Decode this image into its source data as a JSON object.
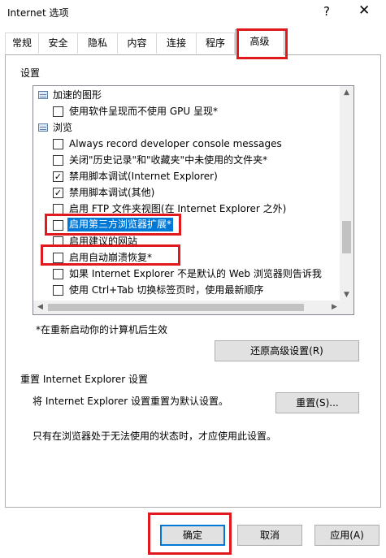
{
  "window": {
    "title": "Internet 选项",
    "help_glyph": "?",
    "close_glyph": "✕"
  },
  "tabs": [
    {
      "label": "常规"
    },
    {
      "label": "安全"
    },
    {
      "label": "隐私"
    },
    {
      "label": "内容"
    },
    {
      "label": "连接"
    },
    {
      "label": "程序"
    },
    {
      "label": "高级",
      "active": true
    }
  ],
  "settings": {
    "heading": "设置",
    "items": [
      {
        "type": "category",
        "label": "加速的图形"
      },
      {
        "type": "check",
        "checked": false,
        "label": "使用软件呈现而不使用 GPU 呈现*"
      },
      {
        "type": "category",
        "label": "浏览"
      },
      {
        "type": "check",
        "checked": false,
        "label": "Always record developer console messages"
      },
      {
        "type": "check",
        "checked": false,
        "label": "关闭\"历史记录\"和\"收藏夹\"中未使用的文件夹*"
      },
      {
        "type": "check",
        "checked": true,
        "label": "禁用脚本调试(Internet Explorer)"
      },
      {
        "type": "check",
        "checked": true,
        "label": "禁用脚本调试(其他)"
      },
      {
        "type": "check",
        "checked": false,
        "label": "启用 FTP 文件夹视图(在 Internet Explorer 之外)"
      },
      {
        "type": "check",
        "checked": false,
        "label": "启用第三方浏览器扩展*",
        "selected": true
      },
      {
        "type": "check",
        "checked": false,
        "label": "启用建议的网站"
      },
      {
        "type": "check",
        "checked": false,
        "label": "启用自动崩溃恢复*"
      },
      {
        "type": "check",
        "checked": false,
        "label": "如果 Internet Explorer 不是默认的 Web 浏览器则告诉我"
      },
      {
        "type": "check",
        "checked": false,
        "label": "使用 Ctrl+Tab 切换标签页时，使用最新顺序"
      }
    ],
    "check_glyph": "✓",
    "restart_note": "*在重新启动你的计算机后生效",
    "restore_button": "还原高级设置(R)"
  },
  "reset": {
    "heading": "重置 Internet Explorer 设置",
    "description": "将 Internet Explorer 设置重置为默认设置。",
    "button": "重置(S)...",
    "note": "只有在浏览器处于无法使用的状态时，才应使用此设置。"
  },
  "footer": {
    "ok": "确定",
    "cancel": "取消",
    "apply": "应用(A)"
  },
  "colors": {
    "highlight": "#e0191e",
    "selection": "#0078d7",
    "button_face": "#e1e1e1"
  }
}
